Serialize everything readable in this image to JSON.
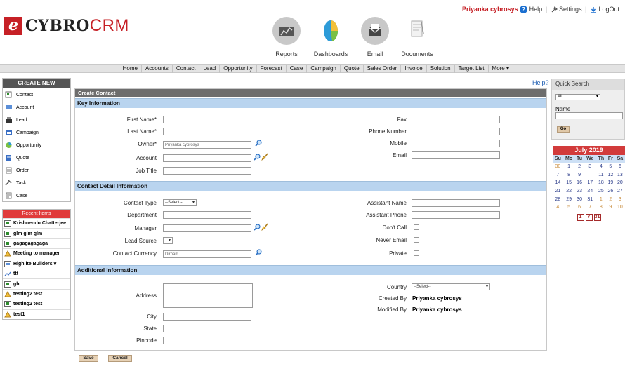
{
  "brand": {
    "prefix": "e",
    "name_a": "CYBRO",
    "name_b": "CRM"
  },
  "topbar": {
    "user": "Priyanka cybrosys",
    "help": "Help",
    "settings": "Settings",
    "logout": "LogOut",
    "sep": "|"
  },
  "modules": [
    {
      "label": "Reports"
    },
    {
      "label": "Dashboards"
    },
    {
      "label": "Email"
    },
    {
      "label": "Documents"
    }
  ],
  "nav": [
    "Home",
    "Accounts",
    "Contact",
    "Lead",
    "Opportunity",
    "Forecast",
    "Case",
    "Campaign",
    "Quote",
    "Sales Order",
    "Invoice",
    "Solution",
    "Target List",
    "More ▾"
  ],
  "create_new": {
    "title": "CREATE NEW",
    "items": [
      "Contact",
      "Account",
      "Lead",
      "Campaign",
      "Opportunity",
      "Quote",
      "Order",
      "Task",
      "Case"
    ]
  },
  "recent": {
    "title": "Recent Items",
    "items": [
      "Krishnendu Chatterjee",
      "glm glm glm",
      "gagagagagaga",
      "Meeting to manager",
      "Highlite Builders v",
      "ttt",
      "gh",
      "testing2 test",
      "testing2 test",
      "test1"
    ]
  },
  "help_link": "Help?",
  "form": {
    "title": "Create Contact",
    "key_info": {
      "title": "Key Information",
      "first_name": "First Name*",
      "last_name": "Last Name*",
      "owner": "Owner*",
      "owner_value": "Priyanka cybrosys",
      "account": "Account",
      "job_title": "Job Title",
      "fax": "Fax",
      "phone_number": "Phone Number",
      "mobile": "Mobile",
      "email": "Email"
    },
    "contact_detail": {
      "title": "Contact Detail Information",
      "contact_type": "Contact Type",
      "contact_type_value": "--Select--",
      "department": "Department",
      "manager": "Manager",
      "lead_source": "Lead Source",
      "contact_currency": "Contact Currency",
      "currency_value": "Dirham",
      "assistant_name": "Assistant Name",
      "assistant_phone": "Assistant Phone",
      "dont_call": "Don't Call",
      "never_email": "Never Email",
      "private": "Private"
    },
    "additional": {
      "title": "Additional Information",
      "address": "Address",
      "city": "City",
      "state": "State",
      "pincode": "Pincode",
      "country": "Country",
      "country_value": "--Select--",
      "created_by": "Created By",
      "created_by_value": "Priyanka cybrosys",
      "modified_by": "Modified By",
      "modified_by_value": "Priyanka cybrosys"
    },
    "save": "Save",
    "cancel": "Cancel"
  },
  "quick_search": {
    "title": "Quick Search",
    "select_value": "All",
    "name_label": "Name",
    "go": "Go"
  },
  "calendar": {
    "title": "July 2019",
    "days": [
      "Su",
      "Mo",
      "Tu",
      "We",
      "Th",
      "Fr",
      "Sa"
    ],
    "weeks": [
      [
        "30",
        "1",
        "2",
        "3",
        "4",
        "5",
        "6"
      ],
      [
        "7",
        "8",
        "9",
        "",
        "11",
        "12",
        "13"
      ],
      [
        "14",
        "15",
        "16",
        "17",
        "18",
        "19",
        "20"
      ],
      [
        "21",
        "22",
        "23",
        "24",
        "25",
        "26",
        "27"
      ],
      [
        "28",
        "29",
        "30",
        "31",
        "1",
        "2",
        "3"
      ],
      [
        "4",
        "5",
        "6",
        "7",
        "8",
        "9",
        "10"
      ]
    ],
    "nav": [
      "1",
      "7",
      "31"
    ]
  }
}
